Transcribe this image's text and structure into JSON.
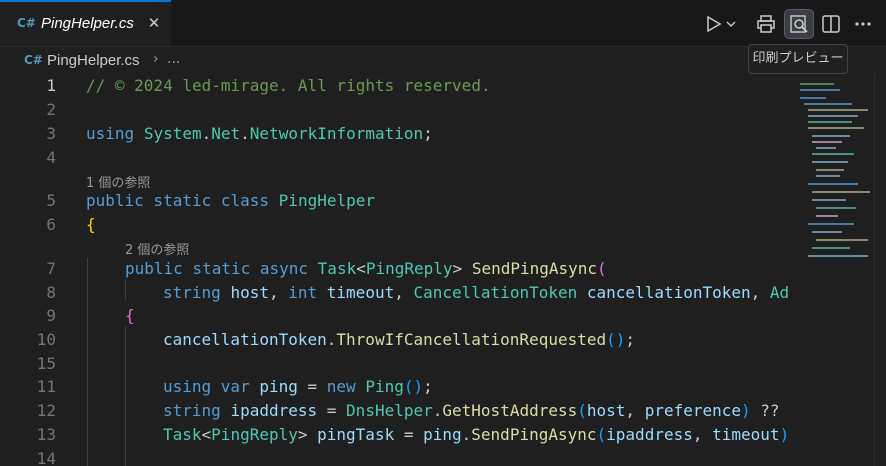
{
  "tab": {
    "label": "PingHelper.cs",
    "icon": "csharp-file-icon",
    "close": "✕"
  },
  "breadcrumb": {
    "file": "PingHelper.cs",
    "separator": "›",
    "more": "..."
  },
  "toolbar": {
    "tooltip": "印刷プレビュー"
  },
  "lens": {
    "refs1": "1 個の参照",
    "refs2": "2 個の参照"
  },
  "line_numbers": [
    "1",
    "2",
    "3",
    "4",
    "5",
    "6",
    "7",
    "8",
    "9",
    "10",
    "11",
    "12",
    "13",
    "14",
    "15"
  ],
  "code": {
    "l1": "// © 2024 led-mirage. All rights reserved.",
    "l3_kw": "using",
    "l3_ns1": "System",
    "l3_ns2": "Net",
    "l3_ns3": "NetworkInformation",
    "l5_kw": "public static class",
    "l5_name": "PingHelper",
    "l7_kw": "public static async",
    "l7_type": "Task",
    "l7_gen": "PingReply",
    "l7_fn": "SendPingAsync",
    "l8_t1": "string",
    "l8_p1": "host",
    "l8_t2": "int",
    "l8_p2": "timeout",
    "l8_t3": "CancellationToken",
    "l8_p3": "cancellationToken",
    "l8_rest": "Ado",
    "l10_obj": "cancellationToken",
    "l10_fn": "ThrowIfCancellationRequested",
    "l12_kw1": "using var",
    "l12_var": "ping",
    "l12_kw2": "new",
    "l12_type": "Ping",
    "l13_t": "string",
    "l13_var": "ipaddress",
    "l13_cls": "DnsHelper",
    "l13_fn": "GetHostAddress",
    "l13_a1": "host",
    "l13_a2": "preference",
    "l13_rest": "?? t",
    "l14_type": "Task",
    "l14_gen": "PingReply",
    "l14_var": "pingTask",
    "l14_obj": "ping",
    "l14_fn": "SendPingAsync",
    "l14_a1": "ipaddress",
    "l14_a2": "timeout"
  }
}
